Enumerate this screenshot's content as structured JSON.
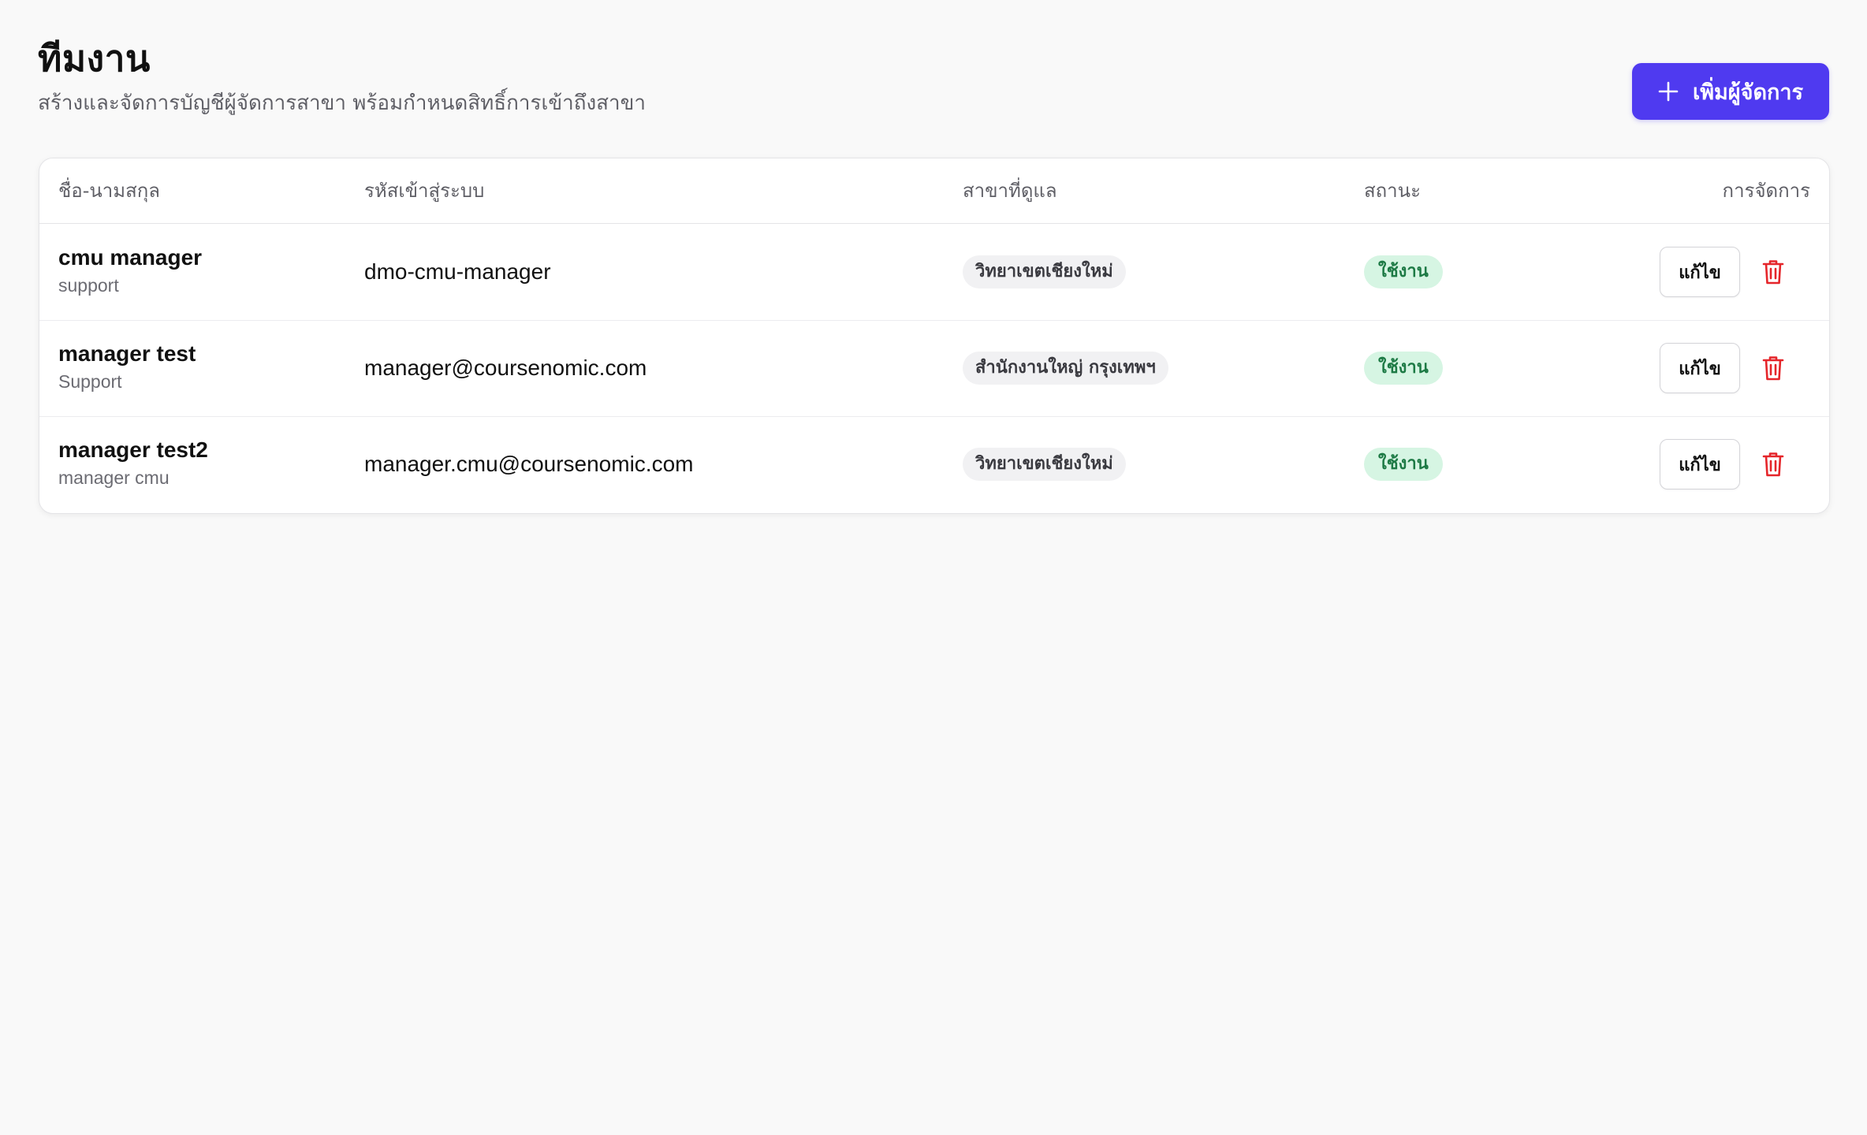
{
  "header": {
    "title": "ทีมงาน",
    "subtitle": "สร้างและจัดการบัญชีผู้จัดการสาขา พร้อมกำหนดสิทธิ์การเข้าถึงสาขา",
    "add_button_label": "เพิ่มผู้จัดการ",
    "add_button_icon": "plus-icon"
  },
  "colors": {
    "accent": "#4f3af0",
    "status_active_bg": "#d6f5e3",
    "status_active_text": "#1d7a45",
    "delete": "#e5252a",
    "background": "#f9f9f9"
  },
  "table": {
    "columns": {
      "name": "ชื่อ-นามสกุล",
      "login": "รหัสเข้าสู่ระบบ",
      "branch": "สาขาที่ดูแล",
      "status": "สถานะ",
      "actions": "การจัดการ"
    },
    "rows": [
      {
        "name": "cmu manager",
        "role": "support",
        "login": "dmo-cmu-manager",
        "branch": "วิทยาเขตเชียงใหม่",
        "status": "ใช้งาน",
        "edit_label": "แก้ไข",
        "delete_icon": "trash-icon"
      },
      {
        "name": "manager test",
        "role": "Support",
        "login": "manager@coursenomic.com",
        "branch": "สำนักงานใหญ่ กรุงเทพฯ",
        "status": "ใช้งาน",
        "edit_label": "แก้ไข",
        "delete_icon": "trash-icon"
      },
      {
        "name": "manager test2",
        "role": "manager cmu",
        "login": "manager.cmu@coursenomic.com",
        "branch": "วิทยาเขตเชียงใหม่",
        "status": "ใช้งาน",
        "edit_label": "แก้ไข",
        "delete_icon": "trash-icon"
      }
    ]
  }
}
